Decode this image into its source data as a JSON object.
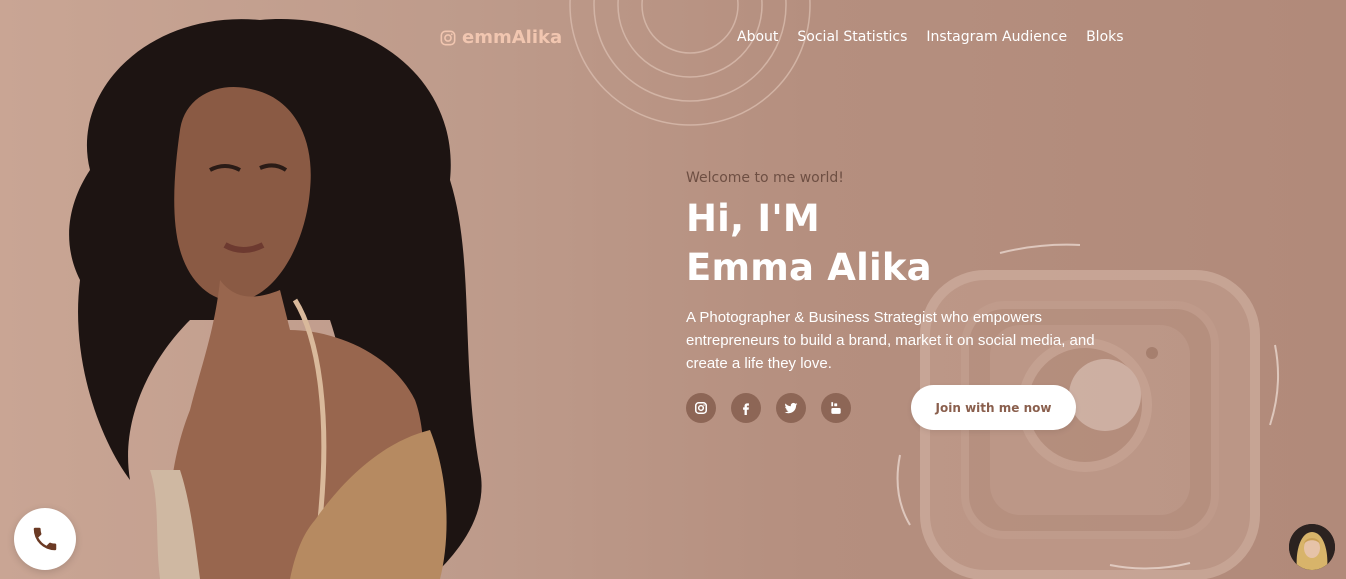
{
  "header": {
    "brand": "emmAlika",
    "nav": [
      "About",
      "Social Statistics",
      "Instagram Audience",
      "Bloks"
    ]
  },
  "hero": {
    "welcome": "Welcome to me world!",
    "headline_line1": "Hi, I'M",
    "headline_line2": "Emma Alika",
    "tagline": "A Photographer & Business Strategist who empowers entrepreneurs to build a brand, market it on social media, and create a life they love.",
    "cta_label": "Join with me now"
  },
  "social_icons": [
    "instagram-icon",
    "facebook-icon",
    "twitter-icon",
    "youtube-icon"
  ],
  "colors": {
    "background": "#b58f7f",
    "brand": "#f1c6b0",
    "icon_circle": "#8d6656",
    "cta_text": "#8a5f4d"
  }
}
